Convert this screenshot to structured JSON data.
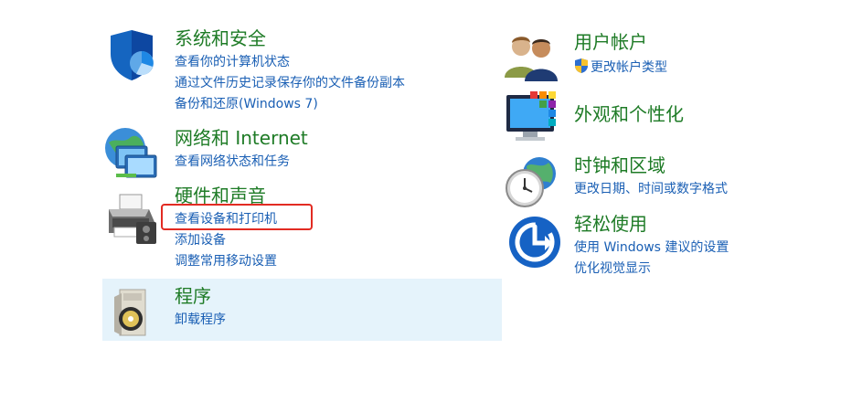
{
  "categories": {
    "system": {
      "title": "系统和安全",
      "links": [
        "查看你的计算机状态",
        "通过文件历史记录保存你的文件备份副本",
        "备份和还原(Windows 7)"
      ],
      "icon": "security-shield-icon"
    },
    "network": {
      "title": "网络和 Internet",
      "links": [
        "查看网络状态和任务"
      ],
      "icon": "network-globe-icon"
    },
    "hardware": {
      "title": "硬件和声音",
      "links": [
        "查看设备和打印机",
        "添加设备",
        "调整常用移动设置"
      ],
      "icon": "printer-icon"
    },
    "programs": {
      "title": "程序",
      "links": [
        "卸载程序"
      ],
      "icon": "programs-disc-icon",
      "highlighted": true
    },
    "users": {
      "title": "用户帐户",
      "links": [
        "更改帐户类型"
      ],
      "icon": "users-icon",
      "link_icon": "uac-shield-icon"
    },
    "appearance": {
      "title": "外观和个性化",
      "links": [],
      "icon": "monitor-palette-icon"
    },
    "clock": {
      "title": "时钟和区域",
      "links": [
        "更改日期、时间或数字格式"
      ],
      "icon": "clock-globe-icon"
    },
    "ease": {
      "title": "轻松使用",
      "links": [
        "使用 Windows 建议的设置",
        "优化视觉显示"
      ],
      "icon": "ease-of-access-icon"
    }
  },
  "colors": {
    "title_green": "#1e7b26",
    "link_blue": "#1a5fb4",
    "hover_bg": "#e5f3fb",
    "annotation_red": "#e22b22"
  }
}
